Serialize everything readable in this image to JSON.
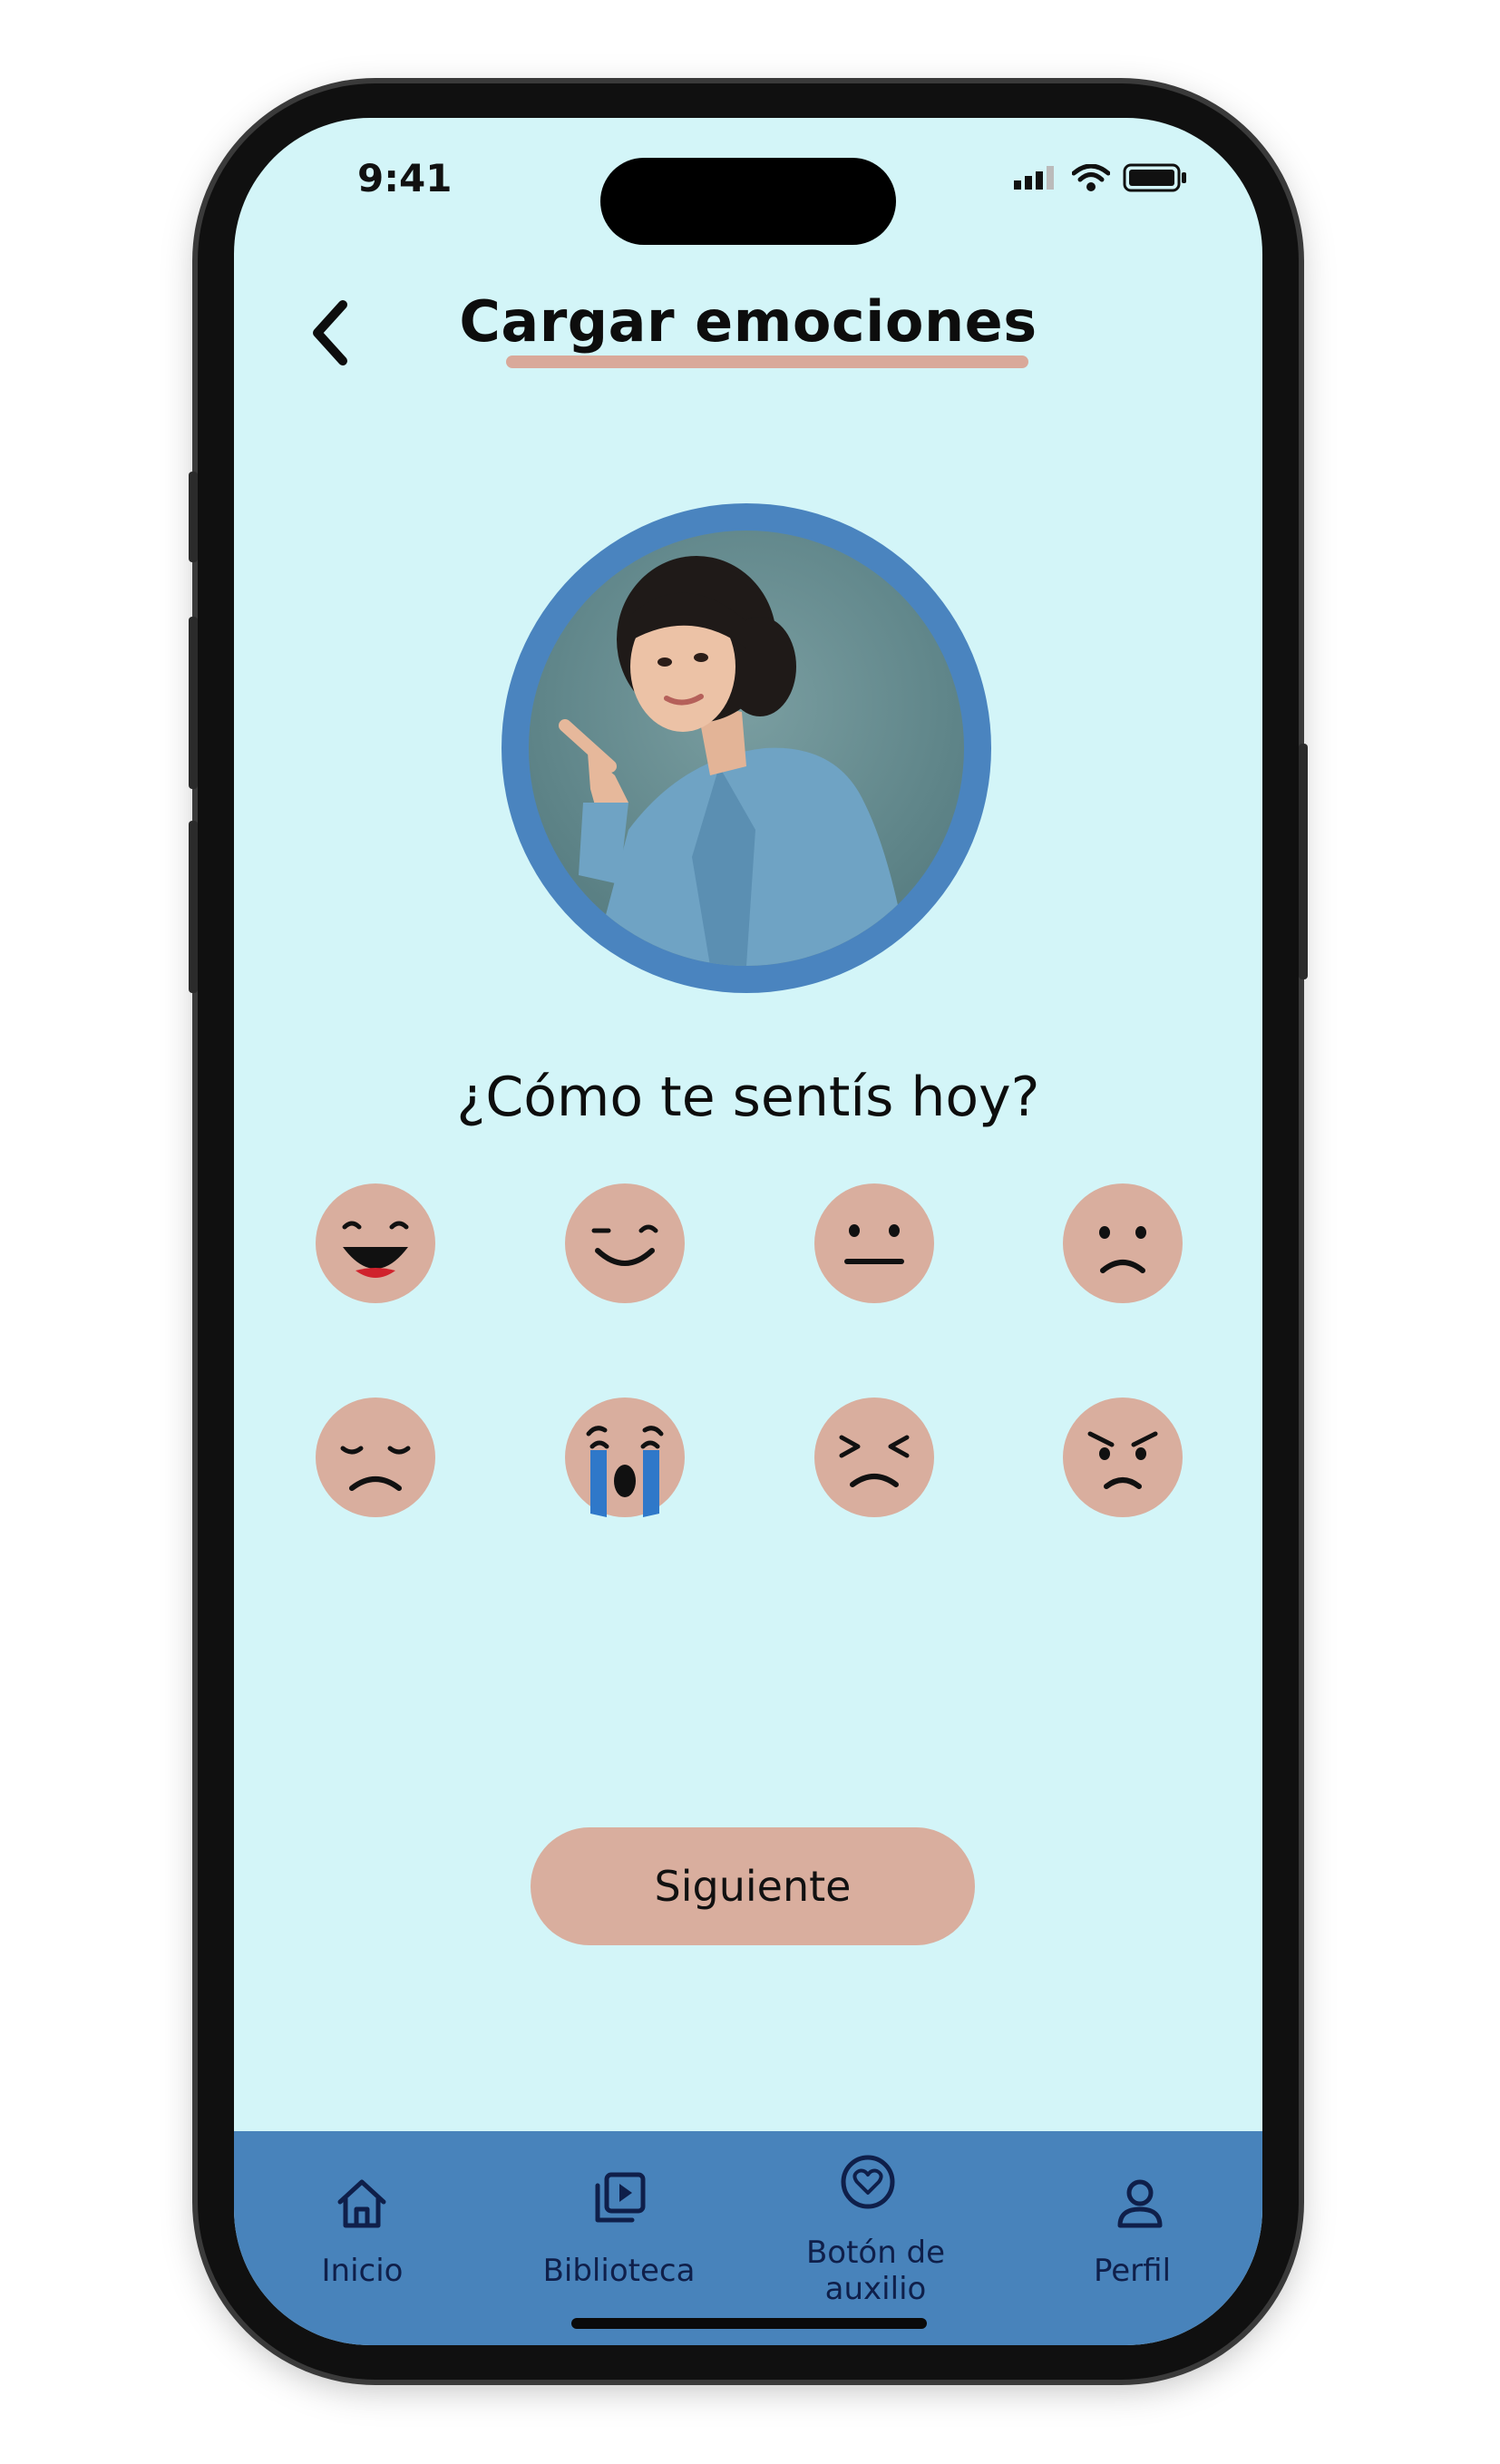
{
  "status": {
    "time": "9:41"
  },
  "header": {
    "title": "Cargar emociones",
    "back_icon": "chevron-left-icon"
  },
  "prompt": {
    "question": "¿Cómo te sentís hoy?"
  },
  "emotions": [
    {
      "name": "laughing"
    },
    {
      "name": "happy"
    },
    {
      "name": "neutral"
    },
    {
      "name": "sad"
    },
    {
      "name": "disappointed"
    },
    {
      "name": "crying"
    },
    {
      "name": "upset"
    },
    {
      "name": "angry"
    }
  ],
  "actions": {
    "next_label": "Siguiente"
  },
  "tabbar": {
    "items": [
      {
        "label": "Inicio",
        "icon": "home-icon"
      },
      {
        "label": "Biblioteca",
        "icon": "library-icon"
      },
      {
        "label": "Botón de",
        "label2": "auxilio",
        "icon": "heart-circle-icon"
      },
      {
        "label": "Perfil",
        "icon": "user-icon"
      }
    ]
  },
  "colors": {
    "background": "#d3f5f8",
    "accent": "#d9ae9e",
    "tabbar": "#4883bb",
    "avatar_ring": "#4a84bf"
  }
}
